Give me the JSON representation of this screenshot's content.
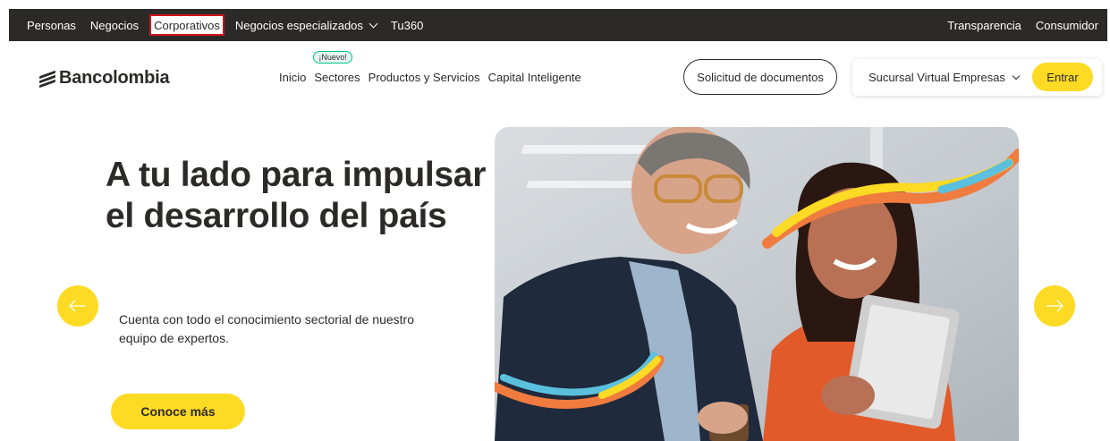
{
  "topbar": {
    "left_items": [
      {
        "label": "Personas",
        "active": false
      },
      {
        "label": "Negocios",
        "active": false
      },
      {
        "label": "Corporativos",
        "active": true
      },
      {
        "label": "Negocios especializados",
        "active": false,
        "has_dropdown": true
      },
      {
        "label": "Tu360",
        "active": false
      }
    ],
    "right_items": [
      {
        "label": "Transparencia"
      },
      {
        "label": "Consumidor"
      }
    ]
  },
  "logo": {
    "text": "Bancolombia",
    "icon": "bancolombia-logo-icon"
  },
  "nav": {
    "items": [
      {
        "label": "Inicio"
      },
      {
        "label": "Sectores",
        "badge": "¡Nuevo!"
      },
      {
        "label": "Productos y Servicios"
      },
      {
        "label": "Capital Inteligente"
      }
    ]
  },
  "docs_button": "Solicitud de documentos",
  "sucursal": {
    "label": "Sucursal Virtual Empresas",
    "button": "Entrar"
  },
  "hero": {
    "title": "A tu lado para impulsar el desarrollo del país",
    "subtitle": "Cuenta con todo el conocimiento sectorial de nuestro equipo de expertos.",
    "cta": "Conoce más",
    "image": "two-professionals-with-tablet-photo"
  },
  "carousel": {
    "prev_icon": "arrow-left-icon",
    "next_icon": "arrow-right-icon"
  },
  "colors": {
    "topbar": "#2c2a29",
    "accent": "#fdda24",
    "active_outline": "#d0111b",
    "badge": "#00c389"
  }
}
